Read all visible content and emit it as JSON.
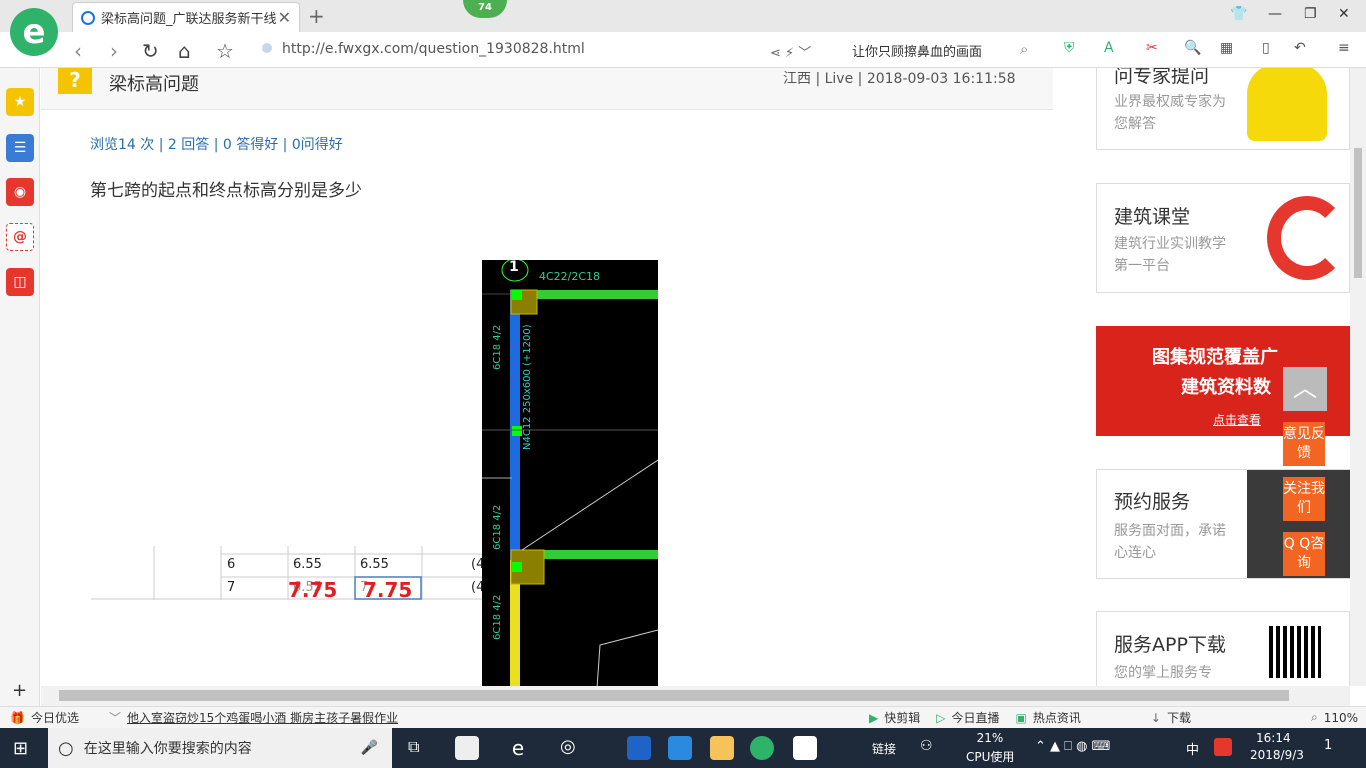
{
  "browser": {
    "tab_title": "梁标高问题_广联达服务新干线",
    "badge_count": "74",
    "url": "http://e.fwxgx.com/question_1930828.html",
    "search_text": "让你只顾擦鼻血的画面"
  },
  "question": {
    "title": "梁标高问题",
    "meta": "江西 | Live | 2018-09-03 16:11:58",
    "stats": "浏览14 次 | 2 回答 | 0 答得好 | 0问得好",
    "text": "第七跨的起点和终点标高分别是多少"
  },
  "cad": {
    "axis_label": "1",
    "top_label": "4C22/2C18",
    "beam_annotation": "N4C12 250x600 (+1200)",
    "left_annot_1": "6C18 4/2",
    "left_annot_2": "6C18 4/2",
    "left_annot_3": "6C18 4/2"
  },
  "sheet": {
    "rows": [
      {
        "no": "6",
        "a": "6.55",
        "b": "6.55",
        "c": "(4"
      },
      {
        "no": "7",
        "a": "6.55",
        "b": "7",
        "c": "(4"
      }
    ],
    "red_a": "7.75",
    "red_b": "7.75"
  },
  "right_cards": [
    {
      "title": "问专家提问",
      "sub": "业界最权威专家为您解答"
    },
    {
      "title": "建筑课堂",
      "sub": "建筑行业实训教学第一平台"
    },
    {
      "title": "图集规范覆盖广",
      "sub": "建筑资料数",
      "cta": "点击查看"
    },
    {
      "title": "预约服务",
      "sub": "服务面对面，承诺心连心"
    },
    {
      "title": "服务APP下载",
      "sub": "您的掌上服务专"
    }
  ],
  "float_buttons": [
    "意见反馈",
    "关注我们",
    "Q Q咨询"
  ],
  "status": {
    "left1": "今日优选",
    "news": "他入室盗窃炒15个鸡蛋喝小酒 撕房主孩子暑假作业",
    "items": [
      "快剪辑",
      "今日直播",
      "热点资讯",
      "下载"
    ],
    "zoom": "110%"
  },
  "taskbar": {
    "search_placeholder": "在这里输入你要搜索的内容",
    "link": "链接",
    "cpu": "21%",
    "cpu_label": "CPU使用",
    "ime": "中",
    "time": "16:14",
    "date": "2018/9/3",
    "notif": "1"
  },
  "colors": {
    "accent": "#2fb36a",
    "link": "#2a6db0",
    "ad_red": "#d9241c",
    "float_orange": "#f26522"
  }
}
